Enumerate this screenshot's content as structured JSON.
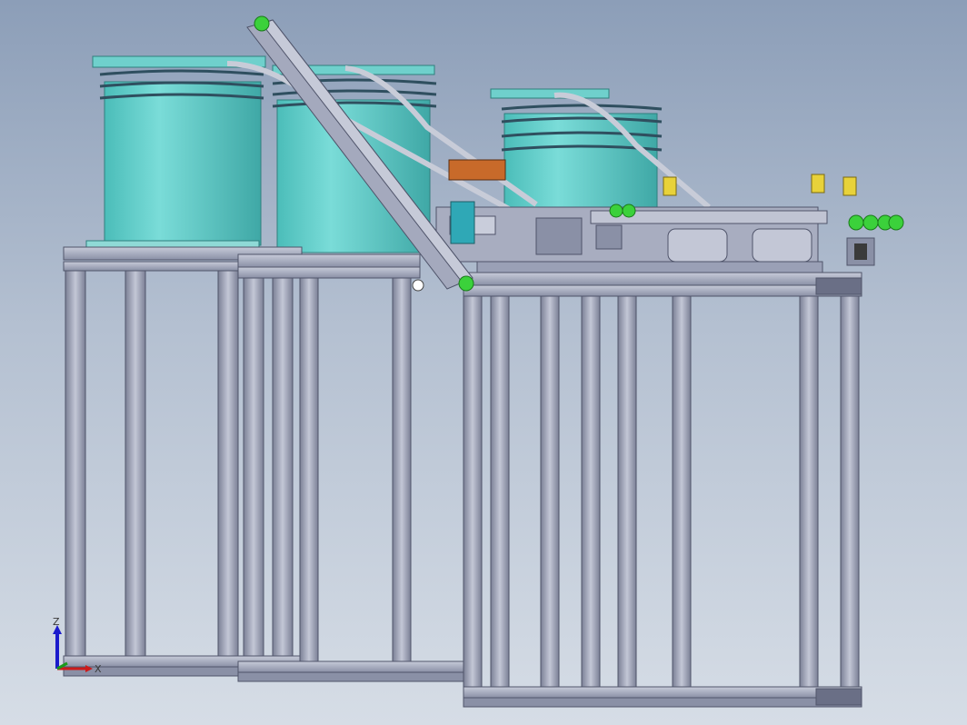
{
  "viewport": {
    "kind": "3d-cad-model-view"
  },
  "triad": {
    "z_label": "Z",
    "x_label": "X",
    "z_color": "#1b1bcc",
    "x_color": "#cc1b1b",
    "y_color": "#1b9a1b"
  },
  "colors": {
    "background_top": "#8c9eb8",
    "background_bottom": "#d6dde6",
    "frame": "#9aa0b6",
    "frame_dark": "#5d6278",
    "drum": "#6fd0cc",
    "drum_dark": "#3fa8a6",
    "accent_green": "#3bd13b",
    "accent_yellow": "#e8d23a",
    "accent_orange": "#c86a2a"
  }
}
